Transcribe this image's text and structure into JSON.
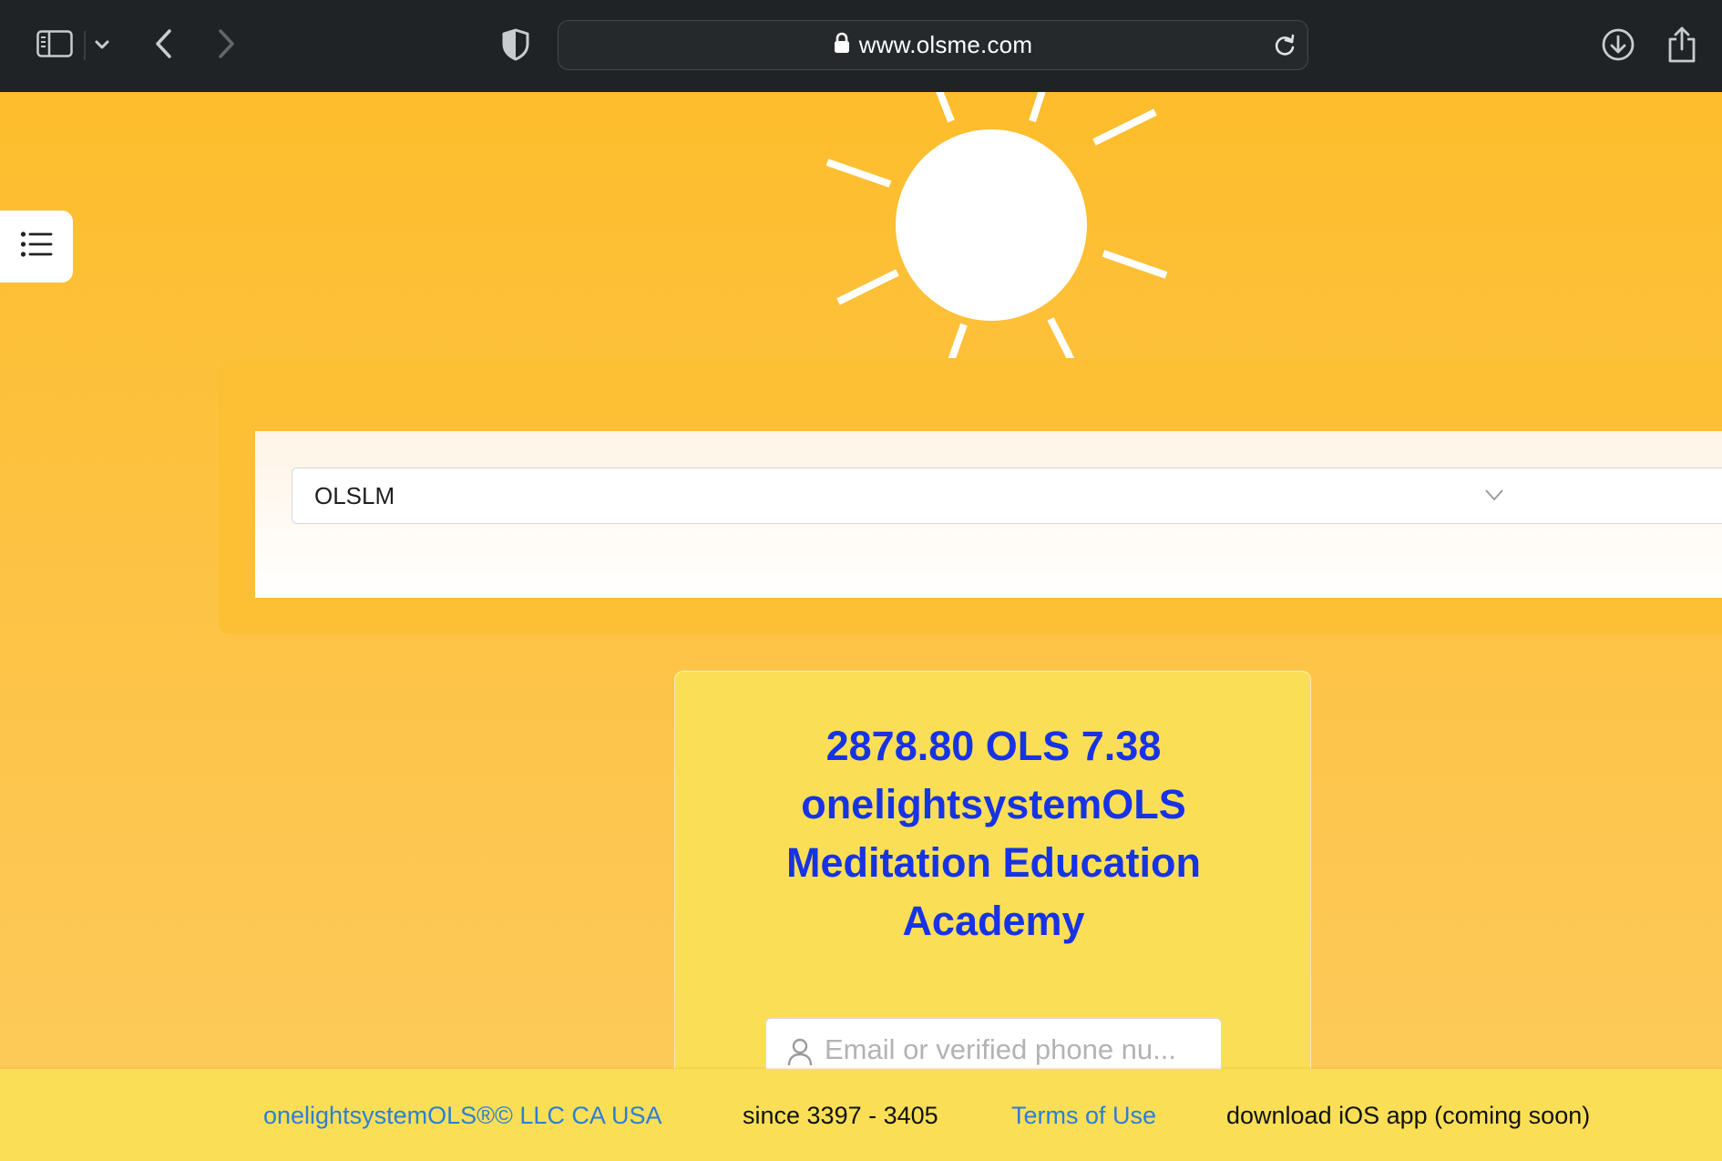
{
  "browser": {
    "url": "www.olsme.com"
  },
  "selector": {
    "selected_value": "OLSLM"
  },
  "card": {
    "title_line1": "2878.80 OLS 7.38",
    "title_line2": "onelightsystemOLS",
    "title_line3": "Meditation Education",
    "title_line4": "Academy",
    "email_placeholder": "Email or verified phone nu..."
  },
  "footer": {
    "company": "onelightsystemOLS®© LLC CA USA",
    "since": "since 3397 - 3405",
    "terms": "Terms of Use",
    "ios": "download iOS app (coming soon)"
  },
  "colors": {
    "toolbar": "#202326",
    "page_background": "#fdbd2c",
    "card_background": "#fadf56",
    "title_text": "#1733e5",
    "link": "#2c7ed6"
  },
  "icons": [
    "sidebar-icon",
    "chevron-down-icon",
    "back-arrow-icon",
    "forward-arrow-icon",
    "shield-icon",
    "lock-icon",
    "reload-icon",
    "download-icon",
    "share-icon",
    "sun-icon",
    "list-menu-icon",
    "user-icon"
  ]
}
